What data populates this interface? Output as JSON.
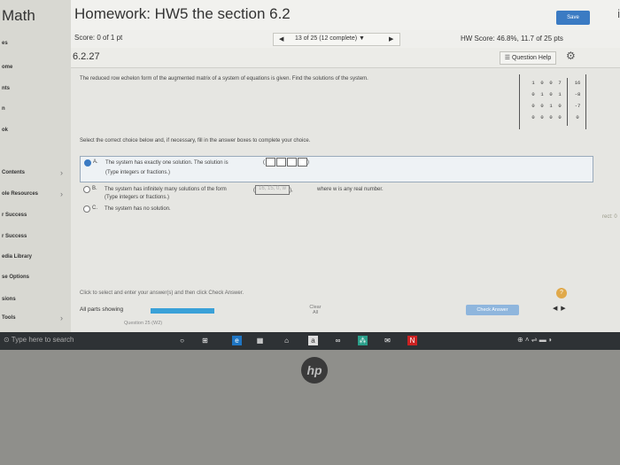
{
  "sidebar": {
    "title": "Math",
    "items": [
      {
        "label": "es"
      },
      {
        "label": "ome"
      },
      {
        "label": "nts"
      },
      {
        "label": "n"
      },
      {
        "label": "ok"
      },
      {
        "label": "Contents"
      },
      {
        "label": "ole Resources"
      },
      {
        "label": "r Success"
      },
      {
        "label": "r Success"
      },
      {
        "label": "edia Library"
      },
      {
        "label": "se Options"
      },
      {
        "label": "sions"
      },
      {
        "label": "Tools"
      }
    ]
  },
  "header": {
    "title": "Homework: HW5 the section 6.2",
    "save_label": "Save",
    "info_glyph": "i"
  },
  "scorebar": {
    "score": "Score: 0 of 1 pt",
    "nav_text": "13 of 25 (12 complete)",
    "hw_score": "HW Score: 46.8%, 11.7 of 25 pts"
  },
  "problem": {
    "number": "6.2.27",
    "help_label": "Question Help",
    "prompt": "The reduced row echelon form of the augmented matrix of a system of equations is given. Find the solutions of the system.",
    "matrix": [
      [
        "1",
        "0",
        "0",
        "7",
        "16"
      ],
      [
        "0",
        "1",
        "0",
        "1",
        "-8"
      ],
      [
        "0",
        "0",
        "1",
        "0",
        "-7"
      ],
      [
        "0",
        "0",
        "0",
        "0",
        "0"
      ]
    ],
    "instruction": "Select the correct choice below and, if necessary, fill in the answer boxes to complete your choice.",
    "choice_a_letter": "A.",
    "choice_a": "The system has exactly one solution. The solution is",
    "choice_a_hint": "(Type integers or fractions.)",
    "choice_b_letter": "B.",
    "choice_b": "The system has infinitely many solutions of the form",
    "choice_b_vector": "16,  15, 0, w",
    "choice_b_tail": "where w is any real number.",
    "choice_b_hint": "(Type integers or fractions.)",
    "choice_c_letter": "C.",
    "choice_c": "The system has no solution.",
    "footer_instruction": "Click to select and enter your answer(s) and then click Check Answer.",
    "all_parts": "All parts showing",
    "progress_fraction": 1.0,
    "clear_label": "Clear All",
    "check_label": "Check Answer",
    "question_link": "Question 25 (W2)",
    "help_glyph": "?",
    "rect_label": "rect: 0"
  },
  "taskbar": {
    "search_placeholder": "Type here to search"
  },
  "brand": {
    "logo": "hp"
  },
  "colors": {
    "accent": "#3b7bc3",
    "progress": "#3aa1d8",
    "help": "#e0a94a"
  }
}
